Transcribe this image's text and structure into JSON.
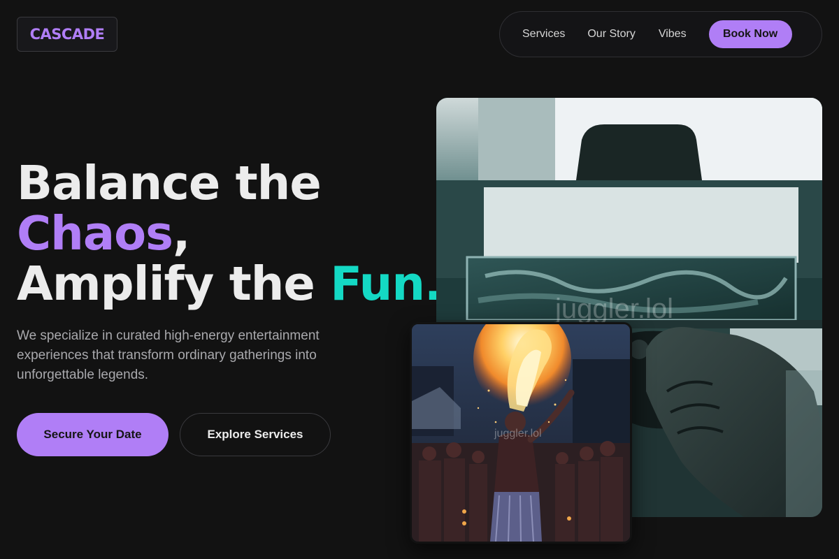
{
  "brand": {
    "name": "CASCADE"
  },
  "nav": {
    "links": [
      "Services",
      "Our Story",
      "Vibes"
    ],
    "cta": "Book Now"
  },
  "hero": {
    "line1": "Balance the",
    "line2_highlight": "Chaos",
    "line2_rest": ",",
    "line3_start": "Amplify the ",
    "line3_highlight": "Fun.",
    "description": "We specialize in curated high-energy entertainment experiences that transform ordinary gatherings into unforgettable legends.",
    "primary_cta": "Secure Your Date",
    "secondary_cta": "Explore Services"
  },
  "images": {
    "main_watermark": "juggler.lol",
    "secondary_watermark": "juggler.lol"
  },
  "colors": {
    "background": "#121212",
    "accent_purple": "#b07ef6",
    "accent_teal": "#14d9c4",
    "text_muted": "#a9a9ad"
  }
}
